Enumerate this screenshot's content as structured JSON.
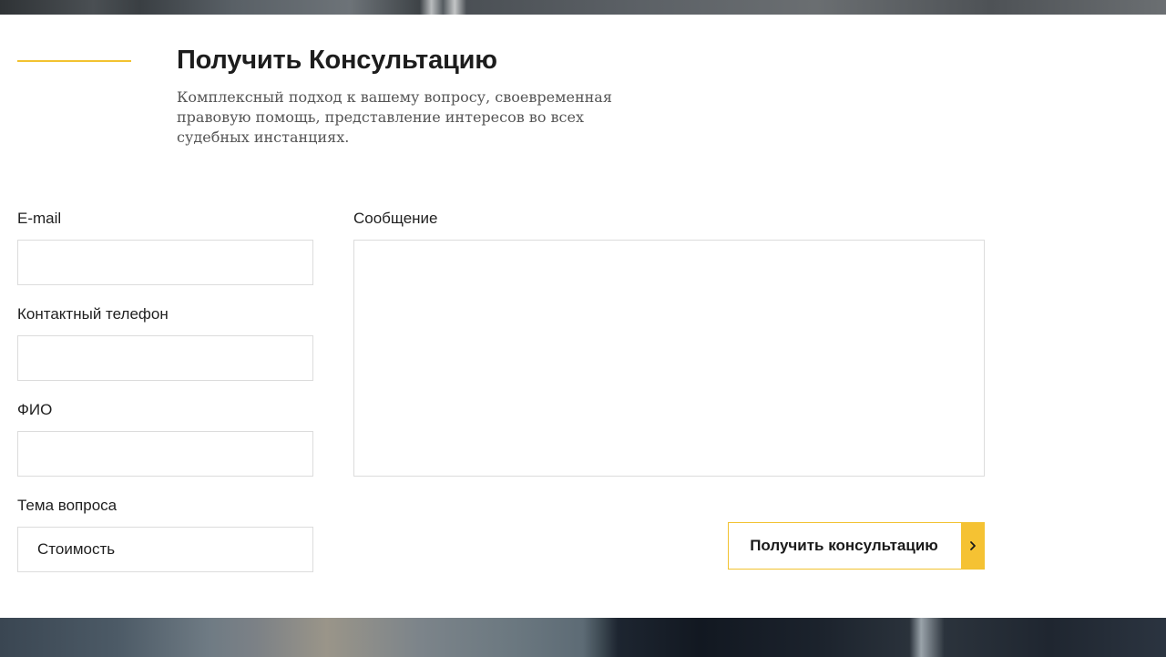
{
  "header": {
    "title": "Получить Консультацию",
    "subtitle": "Комплексный подход к вашему вопросу, своевременная правовую помощь, представление интересов во всех судебных инстанциях."
  },
  "form": {
    "email_label": "E-mail",
    "email_value": "",
    "phone_label": "Контактный телефон",
    "phone_value": "",
    "name_label": "ФИО",
    "name_value": "",
    "topic_label": "Тема вопроса",
    "topic_selected": "Стоимость",
    "message_label": "Сообщение",
    "message_value": "",
    "submit_label": "Получить консультацию"
  },
  "colors": {
    "accent": "#f2c230",
    "border": "#dcdcdc"
  },
  "icons": {
    "submit_arrow": "chevron-right-icon"
  }
}
